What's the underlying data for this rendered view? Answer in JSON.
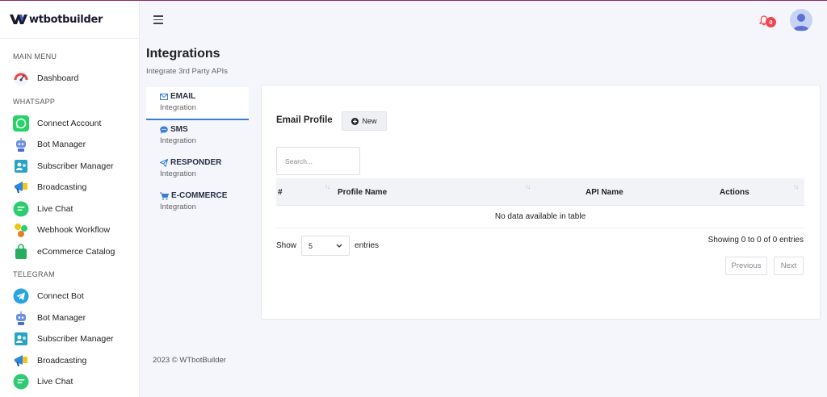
{
  "brand": {
    "name": "wtbotbuilder"
  },
  "sidebar": {
    "sections": [
      {
        "title": "MAIN MENU",
        "items": [
          {
            "label": "Dashboard",
            "icon": "dashboard-icon"
          }
        ]
      },
      {
        "title": "WHATSAPP",
        "items": [
          {
            "label": "Connect Account",
            "icon": "whatsapp-icon"
          },
          {
            "label": "Bot Manager",
            "icon": "robot-icon"
          },
          {
            "label": "Subscriber Manager",
            "icon": "subscribers-icon"
          },
          {
            "label": "Broadcasting",
            "icon": "broadcast-icon"
          },
          {
            "label": "Live Chat",
            "icon": "chat-icon"
          },
          {
            "label": "Webhook Workflow",
            "icon": "webhook-icon"
          },
          {
            "label": "eCommerce Catalog",
            "icon": "shopping-bag-icon"
          }
        ]
      },
      {
        "title": "TELEGRAM",
        "items": [
          {
            "label": "Connect Bot",
            "icon": "telegram-icon"
          },
          {
            "label": "Bot Manager",
            "icon": "robot-icon"
          },
          {
            "label": "Subscriber Manager",
            "icon": "subscribers-icon"
          },
          {
            "label": "Broadcasting",
            "icon": "broadcast-icon"
          },
          {
            "label": "Live Chat",
            "icon": "chat-icon"
          }
        ]
      }
    ]
  },
  "header": {
    "notification_count": "0"
  },
  "page": {
    "title": "Integrations",
    "subtitle": "Integrate 3rd Party APIs"
  },
  "integrations": [
    {
      "title": "EMAIL",
      "sub": "Integration",
      "icon": "envelope-icon",
      "active": true
    },
    {
      "title": "SMS",
      "sub": "Integration",
      "icon": "sms-icon",
      "active": false
    },
    {
      "title": "RESPONDER",
      "sub": "Integration",
      "icon": "paper-plane-icon",
      "active": false
    },
    {
      "title": "E-COMMERCE",
      "sub": "Integration",
      "icon": "cart-icon",
      "active": false
    }
  ],
  "card": {
    "title": "Email Profile",
    "new_label": "New",
    "search_placeholder": "Search...",
    "columns": [
      "#",
      "Profile Name",
      "API Name",
      "Actions"
    ],
    "empty_text": "No data available in table",
    "show_label": "Show",
    "page_size": "5",
    "entries_label": "entries",
    "info": "Showing 0 to 0 of 0 entries",
    "prev_label": "Previous",
    "next_label": "Next"
  },
  "footer": {
    "text": "2023 © WTbotBuilder"
  },
  "colors": {
    "accent": "#3a7bd5",
    "badge": "#f0474f",
    "whatsapp": "#25d366",
    "telegram": "#2aa3e0"
  }
}
